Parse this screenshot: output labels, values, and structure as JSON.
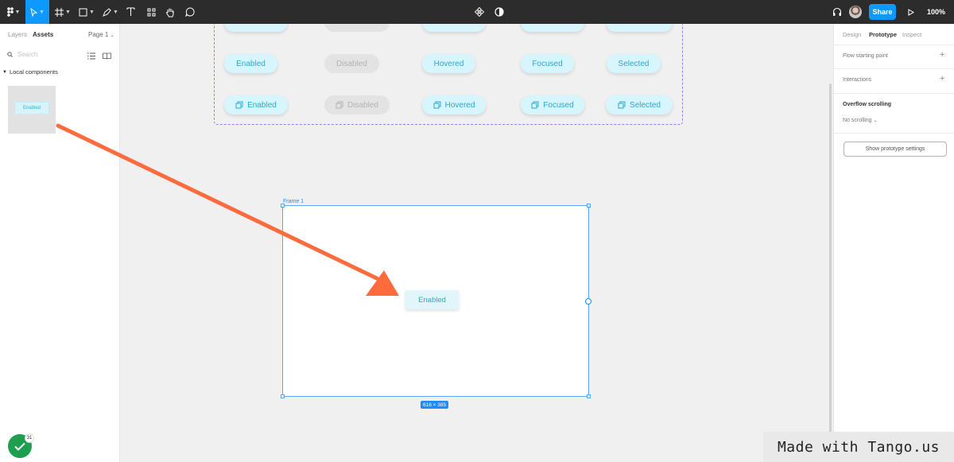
{
  "toolbar": {
    "share_label": "Share",
    "zoom_label": "100%"
  },
  "left_panel": {
    "tabs": [
      "Layers",
      "Assets"
    ],
    "active_tab": "Assets",
    "page_selector": "Page 1",
    "search_placeholder": "Search",
    "section_title": "Local components",
    "component_thumb_label": "Enabled"
  },
  "canvas": {
    "variant_rows": [
      {
        "labels": [
          "Enabled",
          "Disabled",
          "Hovered",
          "Focused",
          "Selected"
        ],
        "with_icon": false
      },
      {
        "labels": [
          "Enabled",
          "Disabled",
          "Hovered",
          "Focused",
          "Selected"
        ],
        "with_icon": true
      }
    ],
    "frame_label": "Frame 1",
    "frame_button_label": "Enabled",
    "size_badge": "616 × 385"
  },
  "right_panel": {
    "tabs": [
      "Design",
      "Prototype",
      "Inspect"
    ],
    "active_tab": "Prototype",
    "flow_starting_point": "Flow starting point",
    "interactions": "Interactions",
    "overflow_scrolling": "Overflow scrolling",
    "scrolling_value": "No scrolling",
    "prototype_settings_button": "Show prototype settings"
  },
  "overlay": {
    "badge_count": "31",
    "watermark": "Made with Tango.us"
  },
  "colors": {
    "accent": "#0d99ff",
    "arrow": "#ff6b3d",
    "badge_green": "#1e9e4f",
    "pill_bg": "#d7f5fc",
    "pill_text": "#2aa9cf"
  }
}
